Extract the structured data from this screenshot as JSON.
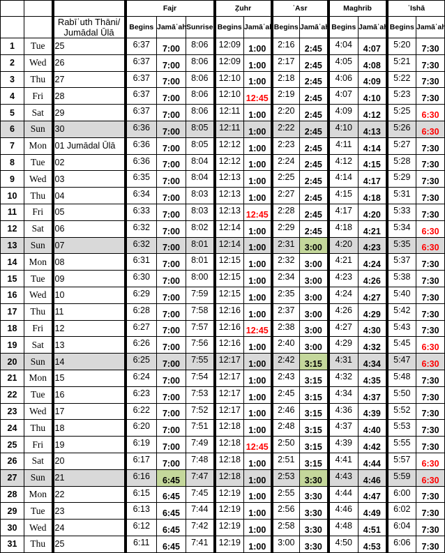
{
  "header": {
    "groups": [
      "Fajr",
      "Ẓuhr",
      "ʿAsr",
      "Maghrib",
      "ʿIshā"
    ],
    "hijri_months": "Rabīʿuth Thāni/ Jumādal Ūlā",
    "begins": "Begins",
    "jamaah": "Jamāʿah",
    "sunrise": "Sunrise"
  },
  "colors": {
    "sunday_row": "#d9d9d9",
    "jamaah_change": "#c4d79b",
    "exception_time": "#ff0000"
  },
  "rows": [
    {
      "n": "1",
      "day": "Tue",
      "hijri": "25",
      "fajr_b": "6:37",
      "fajr_j": "7:00",
      "sunrise": "8:06",
      "zuhr_b": "12:09",
      "zuhr_j": "1:00",
      "asr_b": "2:16",
      "asr_j": "2:45",
      "mag_b": "4:04",
      "mag_j": "4:07",
      "isha_b": "5:20",
      "isha_j": "7:30"
    },
    {
      "n": "2",
      "day": "Wed",
      "hijri": "26",
      "fajr_b": "6:37",
      "fajr_j": "7:00",
      "sunrise": "8:06",
      "zuhr_b": "12:09",
      "zuhr_j": "1:00",
      "asr_b": "2:17",
      "asr_j": "2:45",
      "mag_b": "4:05",
      "mag_j": "4:08",
      "isha_b": "5:21",
      "isha_j": "7:30"
    },
    {
      "n": "3",
      "day": "Thu",
      "hijri": "27",
      "fajr_b": "6:37",
      "fajr_j": "7:00",
      "sunrise": "8:06",
      "zuhr_b": "12:10",
      "zuhr_j": "1:00",
      "asr_b": "2:18",
      "asr_j": "2:45",
      "mag_b": "4:06",
      "mag_j": "4:09",
      "isha_b": "5:22",
      "isha_j": "7:30"
    },
    {
      "n": "4",
      "day": "Fri",
      "hijri": "28",
      "fajr_b": "6:37",
      "fajr_j": "7:00",
      "sunrise": "8:06",
      "zuhr_b": "12:10",
      "zuhr_j": "12:45",
      "asr_b": "2:19",
      "asr_j": "2:45",
      "mag_b": "4:07",
      "mag_j": "4:10",
      "isha_b": "5:23",
      "isha_j": "7:30"
    },
    {
      "n": "5",
      "day": "Sat",
      "hijri": "29",
      "fajr_b": "6:37",
      "fajr_j": "7:00",
      "sunrise": "8:06",
      "zuhr_b": "12:11",
      "zuhr_j": "1:00",
      "asr_b": "2:20",
      "asr_j": "2:45",
      "mag_b": "4:09",
      "mag_j": "4:12",
      "isha_b": "5:25",
      "isha_j": "6:30"
    },
    {
      "n": "6",
      "day": "Sun",
      "hijri": "30",
      "fajr_b": "6:36",
      "fajr_j": "7:00",
      "sunrise": "8:05",
      "zuhr_b": "12:11",
      "zuhr_j": "1:00",
      "asr_b": "2:22",
      "asr_j": "2:45",
      "mag_b": "4:10",
      "mag_j": "4:13",
      "isha_b": "5:26",
      "isha_j": "6:30"
    },
    {
      "n": "7",
      "day": "Mon",
      "hijri": "01 Jumādal Ūlā",
      "fajr_b": "6:36",
      "fajr_j": "7:00",
      "sunrise": "8:05",
      "zuhr_b": "12:12",
      "zuhr_j": "1:00",
      "asr_b": "2:23",
      "asr_j": "2:45",
      "mag_b": "4:11",
      "mag_j": "4:14",
      "isha_b": "5:27",
      "isha_j": "7:30"
    },
    {
      "n": "8",
      "day": "Tue",
      "hijri": "02",
      "fajr_b": "6:36",
      "fajr_j": "7:00",
      "sunrise": "8:04",
      "zuhr_b": "12:12",
      "zuhr_j": "1:00",
      "asr_b": "2:24",
      "asr_j": "2:45",
      "mag_b": "4:12",
      "mag_j": "4:15",
      "isha_b": "5:28",
      "isha_j": "7:30"
    },
    {
      "n": "9",
      "day": "Wed",
      "hijri": "03",
      "fajr_b": "6:35",
      "fajr_j": "7:00",
      "sunrise": "8:04",
      "zuhr_b": "12:13",
      "zuhr_j": "1:00",
      "asr_b": "2:25",
      "asr_j": "2:45",
      "mag_b": "4:14",
      "mag_j": "4:17",
      "isha_b": "5:29",
      "isha_j": "7:30"
    },
    {
      "n": "10",
      "day": "Thu",
      "hijri": "04",
      "fajr_b": "6:34",
      "fajr_j": "7:00",
      "sunrise": "8:03",
      "zuhr_b": "12:13",
      "zuhr_j": "1:00",
      "asr_b": "2:27",
      "asr_j": "2:45",
      "mag_b": "4:15",
      "mag_j": "4:18",
      "isha_b": "5:31",
      "isha_j": "7:30"
    },
    {
      "n": "11",
      "day": "Fri",
      "hijri": "05",
      "fajr_b": "6:33",
      "fajr_j": "7:00",
      "sunrise": "8:03",
      "zuhr_b": "12:13",
      "zuhr_j": "12:45",
      "asr_b": "2:28",
      "asr_j": "2:45",
      "mag_b": "4:17",
      "mag_j": "4:20",
      "isha_b": "5:33",
      "isha_j": "7:30"
    },
    {
      "n": "12",
      "day": "Sat",
      "hijri": "06",
      "fajr_b": "6:32",
      "fajr_j": "7:00",
      "sunrise": "8:02",
      "zuhr_b": "12:14",
      "zuhr_j": "1:00",
      "asr_b": "2:29",
      "asr_j": "2:45",
      "mag_b": "4:18",
      "mag_j": "4:21",
      "isha_b": "5:34",
      "isha_j": "6:30"
    },
    {
      "n": "13",
      "day": "Sun",
      "hijri": "07",
      "fajr_b": "6:32",
      "fajr_j": "7:00",
      "sunrise": "8:01",
      "zuhr_b": "12:14",
      "zuhr_j": "1:00",
      "asr_b": "2:31",
      "asr_j": "3:00",
      "mag_b": "4:20",
      "mag_j": "4:23",
      "isha_b": "5:35",
      "isha_j": "6:30",
      "green": "asr_j"
    },
    {
      "n": "14",
      "day": "Mon",
      "hijri": "08",
      "fajr_b": "6:31",
      "fajr_j": "7:00",
      "sunrise": "8:01",
      "zuhr_b": "12:15",
      "zuhr_j": "1:00",
      "asr_b": "2:32",
      "asr_j": "3:00",
      "mag_b": "4:21",
      "mag_j": "4:24",
      "isha_b": "5:37",
      "isha_j": "7:30"
    },
    {
      "n": "15",
      "day": "Tue",
      "hijri": "09",
      "fajr_b": "6:30",
      "fajr_j": "7:00",
      "sunrise": "8:00",
      "zuhr_b": "12:15",
      "zuhr_j": "1:00",
      "asr_b": "2:34",
      "asr_j": "3:00",
      "mag_b": "4:23",
      "mag_j": "4:26",
      "isha_b": "5:38",
      "isha_j": "7:30"
    },
    {
      "n": "16",
      "day": "Wed",
      "hijri": "10",
      "fajr_b": "6:29",
      "fajr_j": "7:00",
      "sunrise": "7:59",
      "zuhr_b": "12:15",
      "zuhr_j": "1:00",
      "asr_b": "2:35",
      "asr_j": "3:00",
      "mag_b": "4:24",
      "mag_j": "4:27",
      "isha_b": "5:40",
      "isha_j": "7:30"
    },
    {
      "n": "17",
      "day": "Thu",
      "hijri": "11",
      "fajr_b": "6:28",
      "fajr_j": "7:00",
      "sunrise": "7:58",
      "zuhr_b": "12:16",
      "zuhr_j": "1:00",
      "asr_b": "2:37",
      "asr_j": "3:00",
      "mag_b": "4:26",
      "mag_j": "4:29",
      "isha_b": "5:42",
      "isha_j": "7:30"
    },
    {
      "n": "18",
      "day": "Fri",
      "hijri": "12",
      "fajr_b": "6:27",
      "fajr_j": "7:00",
      "sunrise": "7:57",
      "zuhr_b": "12:16",
      "zuhr_j": "12:45",
      "asr_b": "2:38",
      "asr_j": "3:00",
      "mag_b": "4:27",
      "mag_j": "4:30",
      "isha_b": "5:43",
      "isha_j": "7:30"
    },
    {
      "n": "19",
      "day": "Sat",
      "hijri": "13",
      "fajr_b": "6:26",
      "fajr_j": "7:00",
      "sunrise": "7:56",
      "zuhr_b": "12:16",
      "zuhr_j": "1:00",
      "asr_b": "2:40",
      "asr_j": "3:00",
      "mag_b": "4:29",
      "mag_j": "4:32",
      "isha_b": "5:45",
      "isha_j": "6:30"
    },
    {
      "n": "20",
      "day": "Sun",
      "hijri": "14",
      "fajr_b": "6:25",
      "fajr_j": "7:00",
      "sunrise": "7:55",
      "zuhr_b": "12:17",
      "zuhr_j": "1:00",
      "asr_b": "2:42",
      "asr_j": "3:15",
      "mag_b": "4:31",
      "mag_j": "4:34",
      "isha_b": "5:47",
      "isha_j": "6:30",
      "green": "asr_j"
    },
    {
      "n": "21",
      "day": "Mon",
      "hijri": "15",
      "fajr_b": "6:24",
      "fajr_j": "7:00",
      "sunrise": "7:54",
      "zuhr_b": "12:17",
      "zuhr_j": "1:00",
      "asr_b": "2:43",
      "asr_j": "3:15",
      "mag_b": "4:32",
      "mag_j": "4:35",
      "isha_b": "5:48",
      "isha_j": "7:30"
    },
    {
      "n": "22",
      "day": "Tue",
      "hijri": "16",
      "fajr_b": "6:23",
      "fajr_j": "7:00",
      "sunrise": "7:53",
      "zuhr_b": "12:17",
      "zuhr_j": "1:00",
      "asr_b": "2:45",
      "asr_j": "3:15",
      "mag_b": "4:34",
      "mag_j": "4:37",
      "isha_b": "5:50",
      "isha_j": "7:30"
    },
    {
      "n": "23",
      "day": "Wed",
      "hijri": "17",
      "fajr_b": "6:22",
      "fajr_j": "7:00",
      "sunrise": "7:52",
      "zuhr_b": "12:17",
      "zuhr_j": "1:00",
      "asr_b": "2:46",
      "asr_j": "3:15",
      "mag_b": "4:36",
      "mag_j": "4:39",
      "isha_b": "5:52",
      "isha_j": "7:30"
    },
    {
      "n": "24",
      "day": "Thu",
      "hijri": "18",
      "fajr_b": "6:20",
      "fajr_j": "7:00",
      "sunrise": "7:51",
      "zuhr_b": "12:18",
      "zuhr_j": "1:00",
      "asr_b": "2:48",
      "asr_j": "3:15",
      "mag_b": "4:37",
      "mag_j": "4:40",
      "isha_b": "5:53",
      "isha_j": "7:30"
    },
    {
      "n": "25",
      "day": "Fri",
      "hijri": "19",
      "fajr_b": "6:19",
      "fajr_j": "7:00",
      "sunrise": "7:49",
      "zuhr_b": "12:18",
      "zuhr_j": "12:45",
      "asr_b": "2:50",
      "asr_j": "3:15",
      "mag_b": "4:39",
      "mag_j": "4:42",
      "isha_b": "5:55",
      "isha_j": "7:30"
    },
    {
      "n": "26",
      "day": "Sat",
      "hijri": "20",
      "fajr_b": "6:17",
      "fajr_j": "7:00",
      "sunrise": "7:48",
      "zuhr_b": "12:18",
      "zuhr_j": "1:00",
      "asr_b": "2:51",
      "asr_j": "3:15",
      "mag_b": "4:41",
      "mag_j": "4:44",
      "isha_b": "5:57",
      "isha_j": "6:30"
    },
    {
      "n": "27",
      "day": "Sun",
      "hijri": "21",
      "fajr_b": "6:16",
      "fajr_j": "6:45",
      "sunrise": "7:47",
      "zuhr_b": "12:18",
      "zuhr_j": "1:00",
      "asr_b": "2:53",
      "asr_j": "3:30",
      "mag_b": "4:43",
      "mag_j": "4:46",
      "isha_b": "5:59",
      "isha_j": "6:30",
      "green": "fajr_j,asr_j"
    },
    {
      "n": "28",
      "day": "Mon",
      "hijri": "22",
      "fajr_b": "6:15",
      "fajr_j": "6:45",
      "sunrise": "7:45",
      "zuhr_b": "12:19",
      "zuhr_j": "1:00",
      "asr_b": "2:55",
      "asr_j": "3:30",
      "mag_b": "4:44",
      "mag_j": "4:47",
      "isha_b": "6:00",
      "isha_j": "7:30"
    },
    {
      "n": "29",
      "day": "Tue",
      "hijri": "23",
      "fajr_b": "6:13",
      "fajr_j": "6:45",
      "sunrise": "7:44",
      "zuhr_b": "12:19",
      "zuhr_j": "1:00",
      "asr_b": "2:56",
      "asr_j": "3:30",
      "mag_b": "4:46",
      "mag_j": "4:49",
      "isha_b": "6:02",
      "isha_j": "7:30"
    },
    {
      "n": "30",
      "day": "Wed",
      "hijri": "24",
      "fajr_b": "6:12",
      "fajr_j": "6:45",
      "sunrise": "7:42",
      "zuhr_b": "12:19",
      "zuhr_j": "1:00",
      "asr_b": "2:58",
      "asr_j": "3:30",
      "mag_b": "4:48",
      "mag_j": "4:51",
      "isha_b": "6:04",
      "isha_j": "7:30"
    },
    {
      "n": "31",
      "day": "Thu",
      "hijri": "25",
      "fajr_b": "6:11",
      "fajr_j": "6:45",
      "sunrise": "7:41",
      "zuhr_b": "12:19",
      "zuhr_j": "1:00",
      "asr_b": "3:00",
      "asr_j": "3:30",
      "mag_b": "4:50",
      "mag_j": "4:53",
      "isha_b": "6:06",
      "isha_j": "7:30"
    }
  ]
}
